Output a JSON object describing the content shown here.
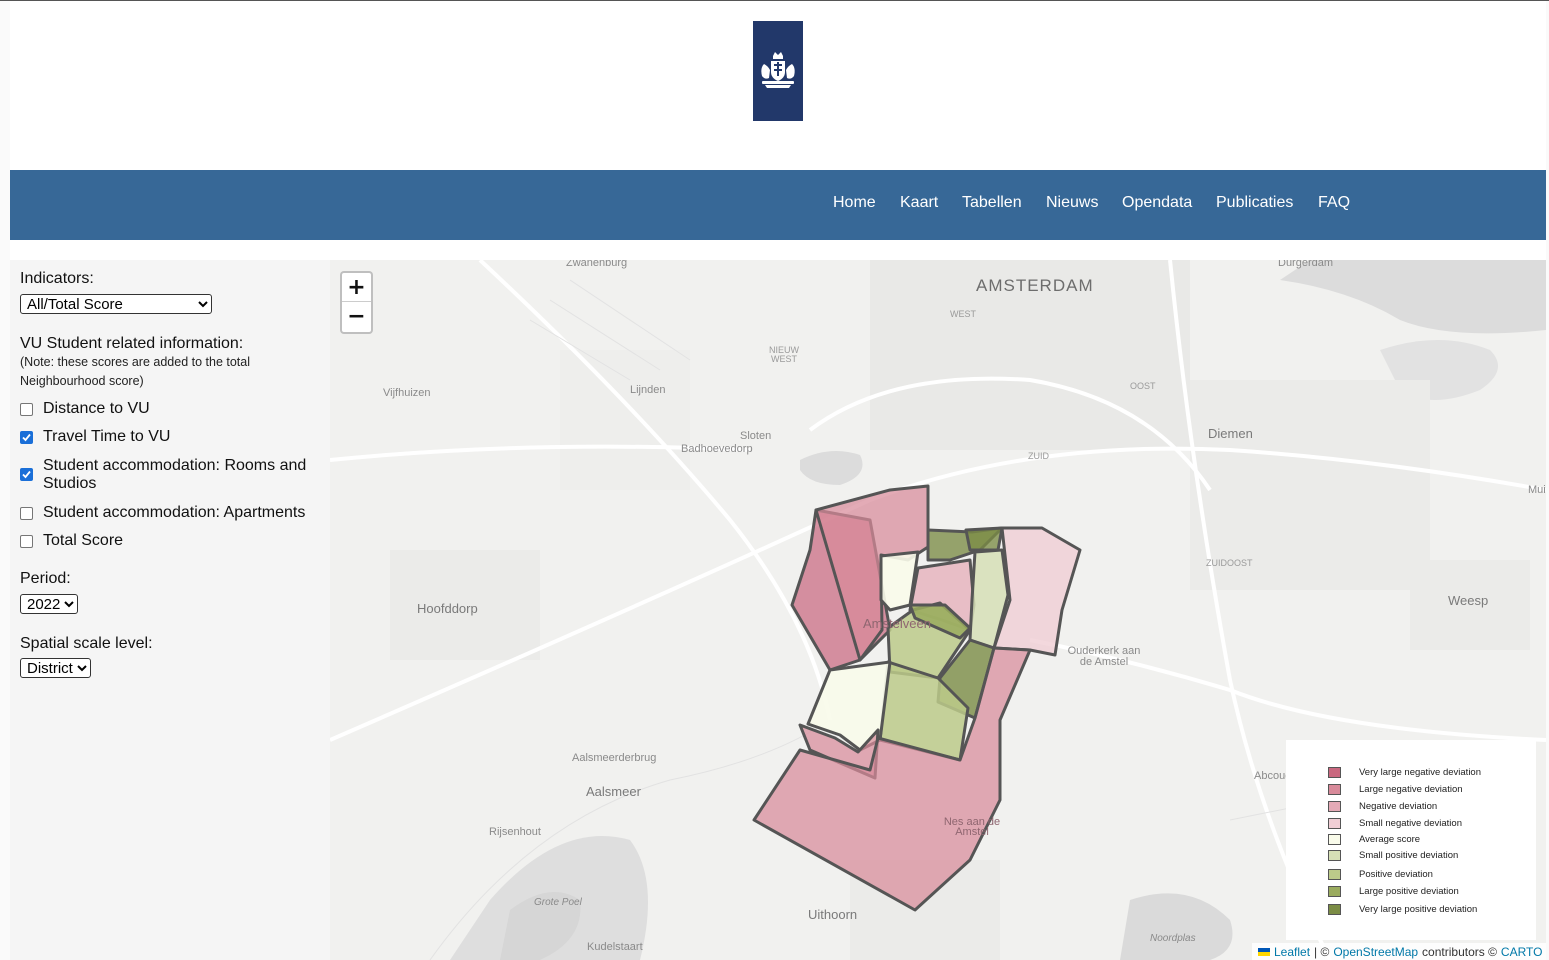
{
  "nav": {
    "items": [
      "Home",
      "Kaart",
      "Tabellen",
      "Nieuws",
      "Opendata",
      "Publicaties",
      "FAQ"
    ]
  },
  "sidebar": {
    "indicators_label": "Indicators:",
    "indicators_value": "All/Total Score",
    "vu_heading": "VU Student related information:",
    "vu_note": "(Note: these scores are added to the total Neighbourhood score)",
    "checkboxes": [
      {
        "label": "Distance to VU",
        "checked": false
      },
      {
        "label": "Travel Time to VU",
        "checked": true
      },
      {
        "label": "Student accommodation: Rooms and Studios",
        "checked": true
      },
      {
        "label": "Student accommodation: Apartments",
        "checked": false
      },
      {
        "label": "Total Score",
        "checked": false
      }
    ],
    "period_label": "Period:",
    "period_value": "2022",
    "scale_label": "Spatial scale level:",
    "scale_value": "District"
  },
  "map": {
    "zoom_in": "+",
    "zoom_out": "−",
    "places": [
      "Zwanenburg",
      "AMSTERDAM",
      "Durgerdam",
      "WEST",
      "NIEUW WEST",
      "Vijfhuizen",
      "Lijnden",
      "OOST",
      "Diemen",
      "Sloten",
      "Badhoevedorp",
      "ZUID",
      "ZUIDOOST",
      "Mui",
      "Hoofddorp",
      "Weesp",
      "Amstelveen",
      "Ouderkerk aan de Amstel",
      "Aalsmeerderbrug",
      "Aalsmeer",
      "Abcoude",
      "Rijsenhout",
      "Nes aan de Amstel",
      "Grote Poel",
      "Uithoorn",
      "Kudelstaart",
      "Noordplas"
    ],
    "legend": [
      {
        "label": "Very large negative deviation",
        "color": "#c9687f"
      },
      {
        "label": "Large negative deviation",
        "color": "#d88a9a"
      },
      {
        "label": "Negative deviation",
        "color": "#e4aab6"
      },
      {
        "label": "Small negative deviation",
        "color": "#f0ced5"
      },
      {
        "label": "Average score",
        "color": "#f9fbea"
      },
      {
        "label": "Small positive deviation",
        "color": "#d6dfb6"
      },
      {
        "label": "Positive deviation",
        "color": "#bcca8a"
      },
      {
        "label": "Large positive deviation",
        "color": "#9aab5e"
      },
      {
        "label": "Very large positive deviation",
        "color": "#7b8c45"
      }
    ],
    "attribution": {
      "leaflet": "Leaflet",
      "sep1": "| ©",
      "osm": "OpenStreetMap",
      "contrib": "contributors ©",
      "carto": "CARTO"
    }
  }
}
